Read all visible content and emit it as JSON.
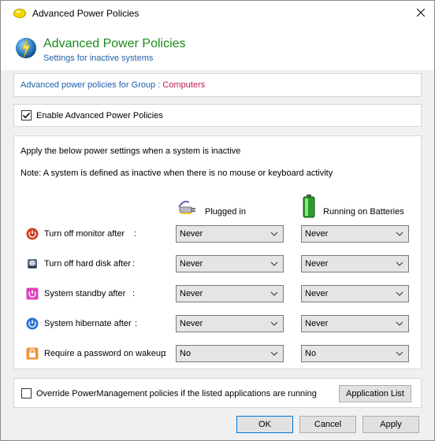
{
  "window": {
    "title": "Advanced Power Policies"
  },
  "header": {
    "title": "Advanced Power Policies",
    "subtitle": "Settings for inactive systems"
  },
  "group": {
    "label": "Advanced power policies for Group",
    "separator": ":",
    "value": "Computers"
  },
  "enable": {
    "label": "Enable Advanced Power Policies",
    "checked": true
  },
  "settings": {
    "intro": "Apply the below power settings when a system is inactive",
    "note": "Note: A system is defined as inactive when there is no mouse or keyboard activity",
    "col_plugged": "Plugged in",
    "col_battery": "Running on Batteries",
    "rows": [
      {
        "label": "Turn off monitor after",
        "colon": ":",
        "icon": "monitor-power-icon",
        "plugged": "Never",
        "battery": "Never"
      },
      {
        "label": "Turn off hard disk after",
        "colon": ":",
        "icon": "hard-disk-icon",
        "plugged": "Never",
        "battery": "Never"
      },
      {
        "label": "System standby after",
        "colon": ":",
        "icon": "standby-icon",
        "plugged": "Never",
        "battery": "Never"
      },
      {
        "label": "System hibernate after",
        "colon": ":",
        "icon": "hibernate-icon",
        "plugged": "Never",
        "battery": "Never"
      },
      {
        "label": "Require a password on wakeup",
        "colon": ":",
        "icon": "lock-icon",
        "plugged": "No",
        "battery": "No"
      }
    ]
  },
  "override": {
    "label": "Override PowerManagement policies if the listed applications are running",
    "checked": false,
    "button": "Application List"
  },
  "footer": {
    "ok": "OK",
    "cancel": "Cancel",
    "apply": "Apply"
  },
  "colors": {
    "title_green": "#1a8a1a",
    "link_blue": "#1f5fa8",
    "group_value": "#c0165a"
  }
}
